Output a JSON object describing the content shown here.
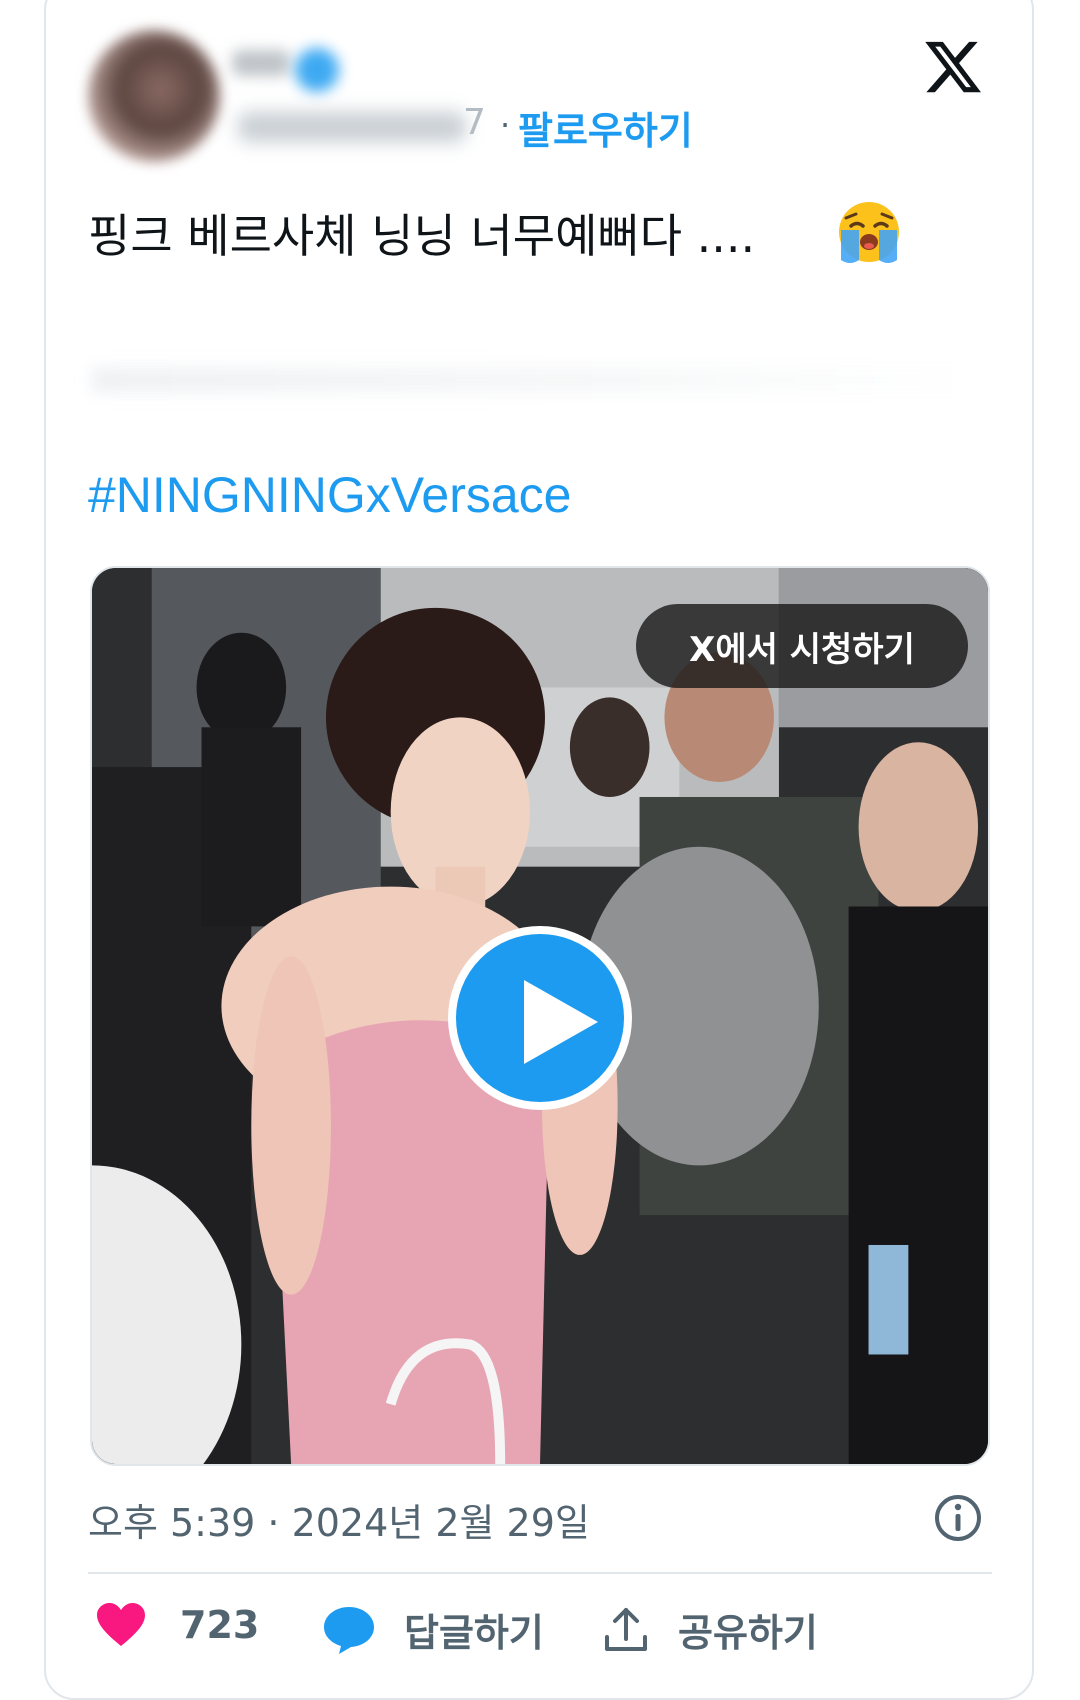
{
  "tweet": {
    "handle_tail": "7",
    "separator": "·",
    "follow_label": "팔로우하기",
    "text": "핑크 베르사체 닝닝 너무예뻐다 ....",
    "hashtag": "#NINGNINGxVersace",
    "timestamp": "오후 5:39 · 2024년 2월 29일"
  },
  "media": {
    "watch_label": "X에서 시청하기"
  },
  "actions": {
    "like_count": "723",
    "reply_label": "답글하기",
    "share_label": "공유하기"
  },
  "icons": {
    "logo": "x-logo-icon",
    "emoji": "loudly-crying-face-icon",
    "play": "play-icon",
    "info": "info-icon",
    "like": "heart-icon",
    "reply": "speech-bubble-icon",
    "share": "share-upload-icon"
  },
  "colors": {
    "accent": "#1d9bf0",
    "like": "#f91880",
    "muted": "#536471",
    "text": "#0f1419"
  }
}
